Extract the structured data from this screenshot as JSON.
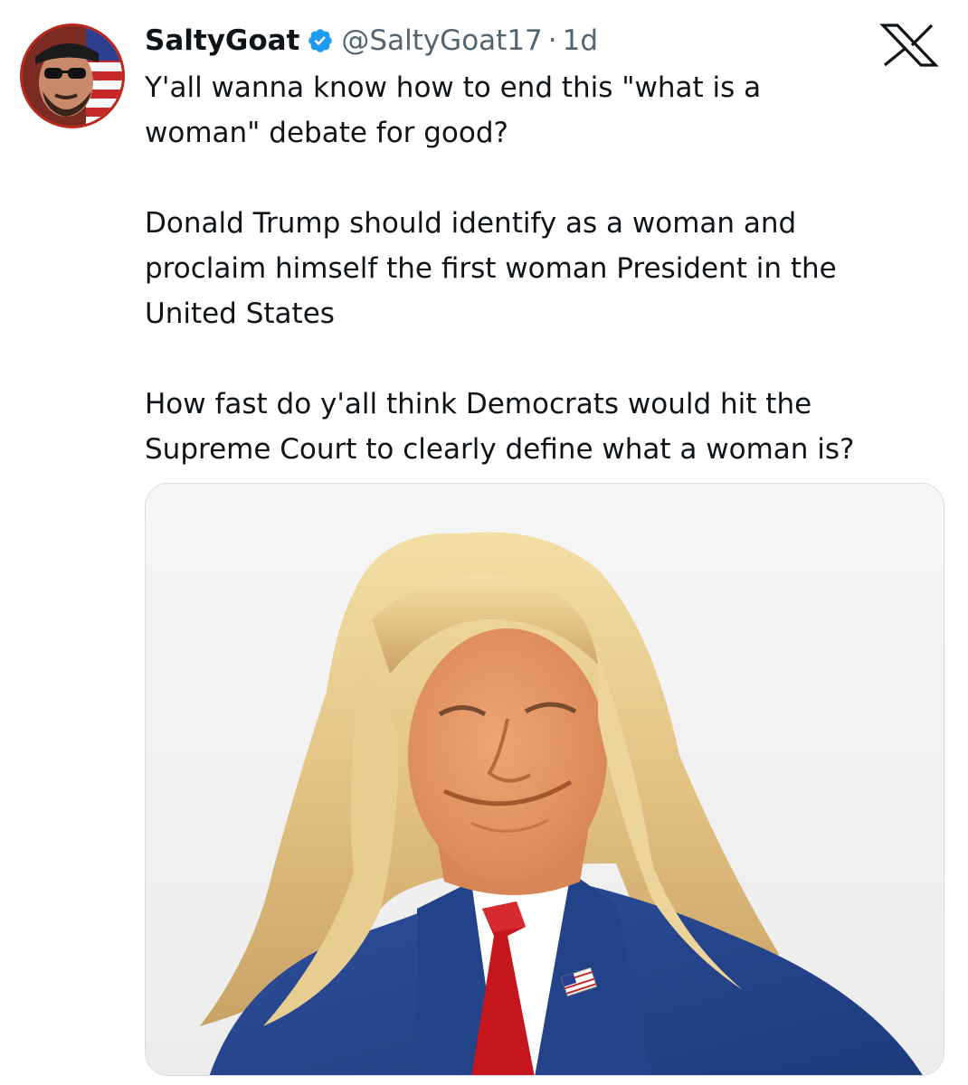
{
  "tweet": {
    "display_name": "SaltyGoat",
    "handle": "@SaltyGoat17",
    "separator": "·",
    "time": "1d",
    "paragraphs": [
      "Y'all wanna know how to end this \"what is a\nwoman\" debate for good?",
      "Donald Trump should identify as a woman and\nproclaim himself the first woman President in the\nUnited States",
      "How fast do y'all think Democrats would hit the\nSupreme Court to clearly define what a woman is?"
    ]
  },
  "icons": {
    "verified": "verified-badge-icon",
    "platform": "x-logo-icon"
  },
  "colors": {
    "text": "#0f1419",
    "secondary": "#536471",
    "verified_blue": "#1d9bf0",
    "avatar_border": "#b8281d"
  }
}
